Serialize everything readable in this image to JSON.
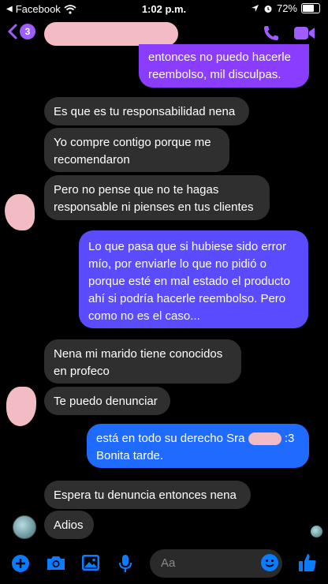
{
  "status_bar": {
    "back_app": "Facebook",
    "time": "1:02 p.m.",
    "battery": "72%",
    "battery_level": 0.72
  },
  "header": {
    "unread_count": "3",
    "contact_name_redacted": true
  },
  "messages": [
    {
      "from": "me",
      "text": "entonces no puedo hacerle reembolso, mil disculpas."
    },
    {
      "from": "them",
      "text": "Es que es tu responsabilidad nena"
    },
    {
      "from": "them",
      "text": "Yo compre contigo porque me recomendaron"
    },
    {
      "from": "them",
      "text": "Pero no pense que no te hagas responsable ni pienses en tus clientes"
    },
    {
      "from": "me",
      "text": "Lo que pasa que si hubiese sido error mío, por enviarle lo que no pidió o porque esté en mal estado el producto ahí si podría hacerle reembolso. Pero como no es el caso..."
    },
    {
      "from": "them",
      "text": "Nena mi marido tiene conocidos en profeco"
    },
    {
      "from": "them",
      "text": "Te puedo denunciar"
    },
    {
      "from": "me",
      "text_a": "está en todo su derecho Sra",
      "text_b": ":3",
      "text_c": "Bonita tarde."
    },
    {
      "from": "them",
      "text": "Espera tu denuncia entonces nena"
    },
    {
      "from": "them",
      "text": "Adios"
    }
  ],
  "composer": {
    "placeholder": "Aa"
  },
  "colors": {
    "accent": "#0a7cff",
    "incoming_bubble": "#2f2f2f",
    "outgoing_top": "#8a3dff",
    "outgoing_mid": "#5b4bff",
    "outgoing_bottom": "#1f6bff",
    "redaction": "#f3bcc4"
  },
  "icons": [
    "wifi-icon",
    "location-icon",
    "alarm-icon",
    "back-chevron-icon",
    "phone-icon",
    "video-icon",
    "plus-icon",
    "camera-icon",
    "gallery-icon",
    "mic-icon",
    "emoji-icon",
    "like-icon"
  ]
}
